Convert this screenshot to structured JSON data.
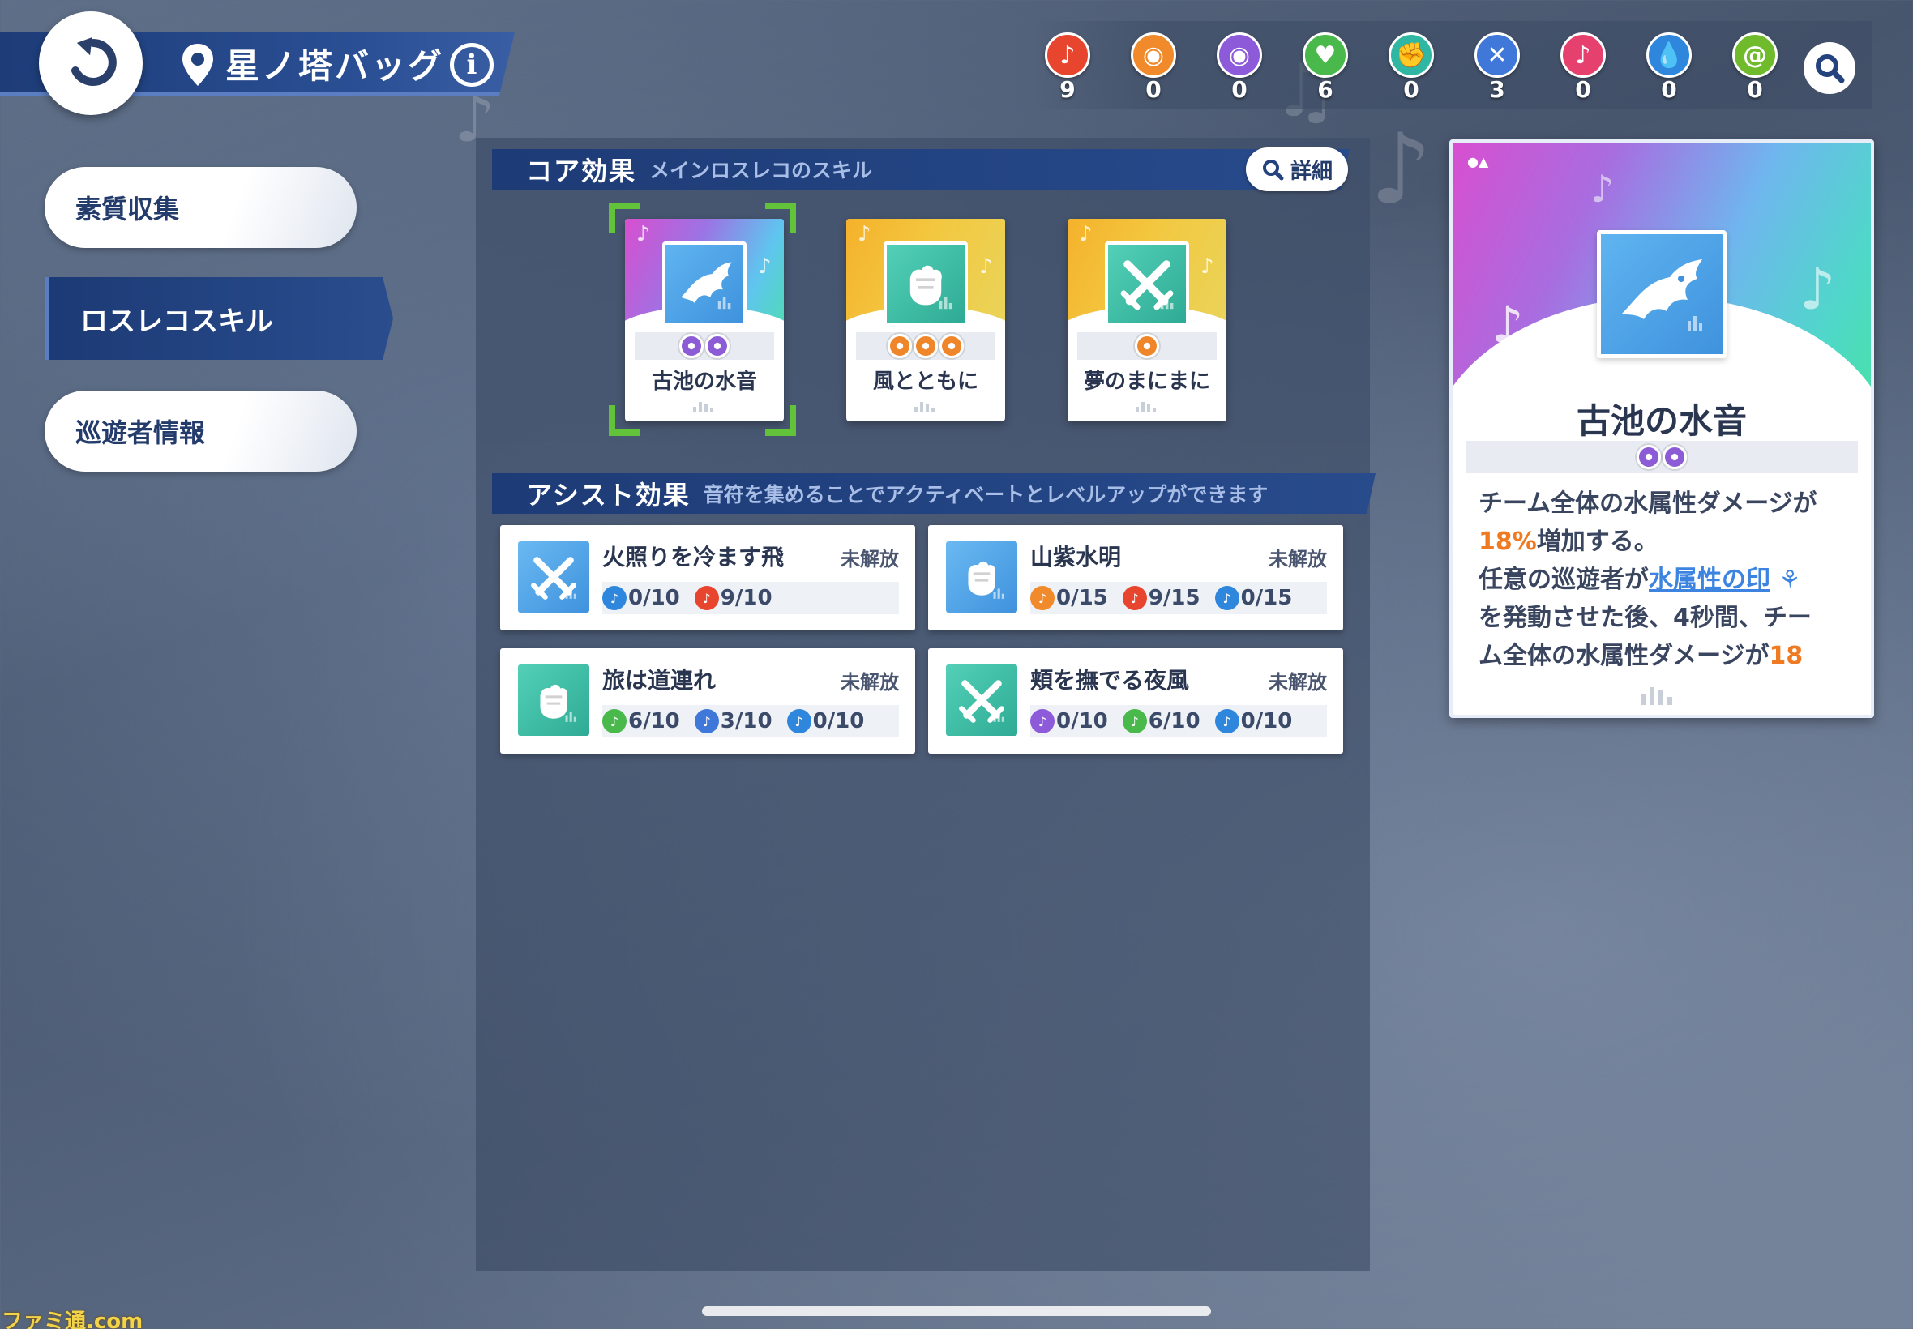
{
  "header": {
    "title": "星ノ塔バッグ",
    "info_label": "i"
  },
  "notes": [
    {
      "icon": "red-sword-note-icon",
      "color": "#e8452f",
      "glyph": "♪",
      "count": "9"
    },
    {
      "icon": "orange-eye-note-icon",
      "color": "#f08a2a",
      "glyph": "◉",
      "count": "0"
    },
    {
      "icon": "purple-eye-note-icon",
      "color": "#8d5bd9",
      "glyph": "◉",
      "count": "0"
    },
    {
      "icon": "green-heart-note-icon",
      "color": "#48b94a",
      "glyph": "♥",
      "count": "6"
    },
    {
      "icon": "teal-fist-note-icon",
      "color": "#2fb7a3",
      "glyph": "✊",
      "count": "0"
    },
    {
      "icon": "blue-crossed-swords-note-icon",
      "color": "#3f78d9",
      "glyph": "✕",
      "count": "3"
    },
    {
      "icon": "pink-flame-note-icon",
      "color": "#e6406e",
      "glyph": "♪",
      "count": "0"
    },
    {
      "icon": "blue-water-note-icon",
      "color": "#2f86dd",
      "glyph": "💧",
      "count": "0"
    },
    {
      "icon": "green-wind-note-icon",
      "color": "#6fbb2c",
      "glyph": "@",
      "count": "0"
    }
  ],
  "menu": {
    "items": [
      "素質収集",
      "ロスレコスキル",
      "巡遊者情報"
    ]
  },
  "core": {
    "title": "コア効果",
    "subtitle": "メインロスレコのスキル",
    "detail_label": "詳細",
    "cards": [
      {
        "name": "古池の水音",
        "pips": 2,
        "pip_color": "purple",
        "grad": "linear-gradient(115deg,#d84fd0 0%,#9b74e4 40%,#5fc5ef 75%,#4fdcb5 100%)",
        "icon_bg": "linear-gradient(135deg,#5fb4f0,#3f92dd)",
        "icon": "water-dragon-icon"
      },
      {
        "name": "風とともに",
        "pips": 3,
        "pip_color": "orange",
        "grad": "linear-gradient(115deg,#f5b12b 0%,#f3c840 45%,#e9d45a 100%)",
        "icon_bg": "linear-gradient(135deg,#53d0b7,#2fab95)",
        "icon": "fist-icon"
      },
      {
        "name": "夢のまにまに",
        "pips": 1,
        "pip_color": "orange",
        "grad": "linear-gradient(115deg,#f5b12b 0%,#f3c840 45%,#e9d45a 100%)",
        "icon_bg": "linear-gradient(135deg,#53d0b7,#2fab95)",
        "icon": "crossed-swords-icon"
      }
    ]
  },
  "assist": {
    "title": "アシスト効果",
    "subtitle": "音符を集めることでアクティベートとレベルアップができます",
    "cards": [
      {
        "name": "火照りを冷ます飛",
        "status": "未解放",
        "icon": "crossed-swords-icon",
        "icon_bg": "linear-gradient(135deg,#6ab9f2,#3f92dd)",
        "reqs": [
          {
            "color": "#2f86dd",
            "text": "0/10"
          },
          {
            "color": "#e8452f",
            "text": "9/10"
          }
        ]
      },
      {
        "name": "山紫水明",
        "status": "未解放",
        "icon": "fist-icon",
        "icon_bg": "linear-gradient(135deg,#6ab9f2,#3f92dd)",
        "reqs": [
          {
            "color": "#f08a2a",
            "text": "0/15"
          },
          {
            "color": "#e8452f",
            "text": "9/15"
          },
          {
            "color": "#2f86dd",
            "text": "0/15"
          }
        ]
      },
      {
        "name": "旅は道連れ",
        "status": "未解放",
        "icon": "fist-icon",
        "icon_bg": "linear-gradient(135deg,#53d0b7,#2fab95)",
        "reqs": [
          {
            "color": "#48b94a",
            "text": "6/10"
          },
          {
            "color": "#3f78d9",
            "text": "3/10"
          },
          {
            "color": "#2f86dd",
            "text": "0/10"
          }
        ]
      },
      {
        "name": "頬を撫でる夜風",
        "status": "未解放",
        "icon": "crossed-swords-icon",
        "icon_bg": "linear-gradient(135deg,#53d0b7,#2fab95)",
        "reqs": [
          {
            "color": "#8d5bd9",
            "text": "0/10"
          },
          {
            "color": "#48b94a",
            "text": "6/10"
          },
          {
            "color": "#2f86dd",
            "text": "0/10"
          }
        ]
      }
    ]
  },
  "detail": {
    "title": "古池の水音",
    "desc_1": "チーム全体の水属性ダメージが",
    "desc_2_hl": "18%",
    "desc_2": "増加する。",
    "desc_3": "任意の巡遊者が",
    "desc_3_link": "水属性の印",
    "desc_4": "を発動させた後、4秒間、チー",
    "desc_5": "ム全体の水属性ダメージが",
    "desc_5_hl": "18"
  },
  "watermark": "ファミ通.com"
}
